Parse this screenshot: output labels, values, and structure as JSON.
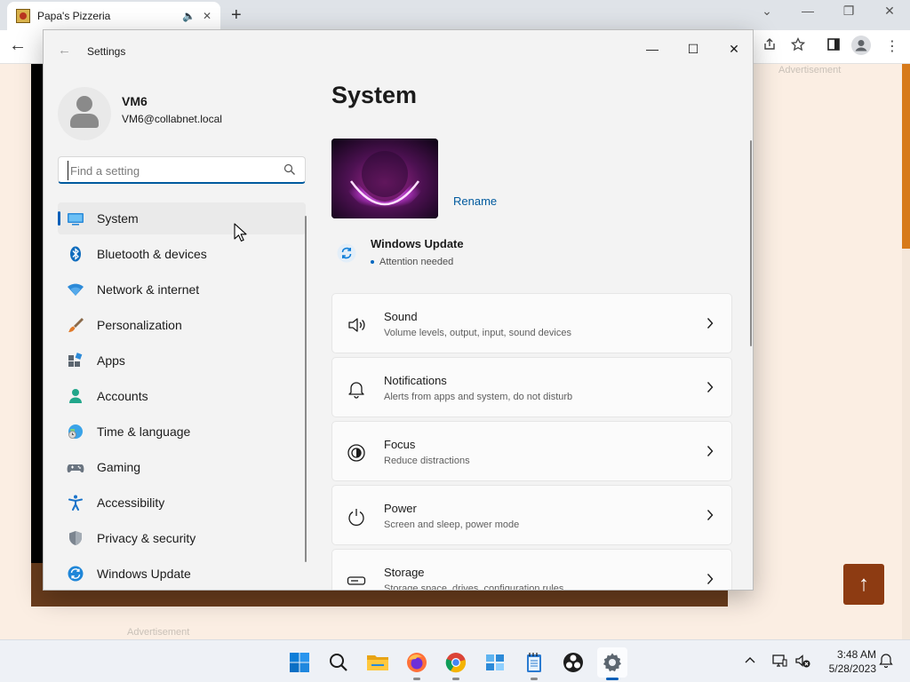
{
  "browser": {
    "tab_title": "Papa's Pizzeria",
    "new_tab_glyph": "+",
    "back_glyph": "←",
    "ad_label_right": "Advertisement",
    "ad_label_bottom": "Advertisement",
    "scroll_top_glyph": "↑",
    "window_controls": {
      "tab_search": "⌄",
      "minimize": "—",
      "restore": "❐",
      "close": "✕"
    }
  },
  "settings": {
    "window_title": "Settings",
    "back_glyph": "←",
    "controls": {
      "minimize": "—",
      "maximize": "☐",
      "close": "✕"
    },
    "user": {
      "name": "VM6",
      "email": "VM6@collabnet.local"
    },
    "search": {
      "placeholder": "Find a setting",
      "value": ""
    },
    "nav": [
      {
        "label": "System",
        "icon": "monitor-icon",
        "selected": true
      },
      {
        "label": "Bluetooth & devices",
        "icon": "bluetooth-icon"
      },
      {
        "label": "Network & internet",
        "icon": "wifi-icon"
      },
      {
        "label": "Personalization",
        "icon": "brush-icon"
      },
      {
        "label": "Apps",
        "icon": "apps-icon"
      },
      {
        "label": "Accounts",
        "icon": "person-icon"
      },
      {
        "label": "Time & language",
        "icon": "globe-clock-icon"
      },
      {
        "label": "Gaming",
        "icon": "gamepad-icon"
      },
      {
        "label": "Accessibility",
        "icon": "accessibility-icon"
      },
      {
        "label": "Privacy & security",
        "icon": "shield-icon"
      },
      {
        "label": "Windows Update",
        "icon": "update-icon"
      }
    ],
    "content": {
      "title": "System",
      "rename_label": "Rename",
      "update": {
        "title": "Windows Update",
        "status": "Attention needed"
      },
      "cards": [
        {
          "title": "Sound",
          "subtitle": "Volume levels, output, input, sound devices",
          "icon": "speaker-icon"
        },
        {
          "title": "Notifications",
          "subtitle": "Alerts from apps and system, do not disturb",
          "icon": "bell-icon"
        },
        {
          "title": "Focus",
          "subtitle": "Reduce distractions",
          "icon": "focus-icon"
        },
        {
          "title": "Power",
          "subtitle": "Screen and sleep, power mode",
          "icon": "power-icon"
        },
        {
          "title": "Storage",
          "subtitle": "Storage space, drives, configuration rules",
          "icon": "storage-icon"
        }
      ]
    }
  },
  "taskbar": {
    "apps": [
      "start-icon",
      "search-icon",
      "file-explorer-icon",
      "firefox-icon",
      "chrome-icon",
      "app-icon",
      "notepad-icon",
      "obs-icon",
      "settings-gear-icon"
    ],
    "active_app": "settings-gear-icon",
    "clock": {
      "time": "3:48 AM",
      "date": "5/28/2023"
    }
  },
  "colors": {
    "accent": "#005fb8",
    "link": "#005a9e",
    "update_blue": "#0f7ed8",
    "game_brown": "#6a3d1d",
    "page_orange": "#d77a1a"
  }
}
